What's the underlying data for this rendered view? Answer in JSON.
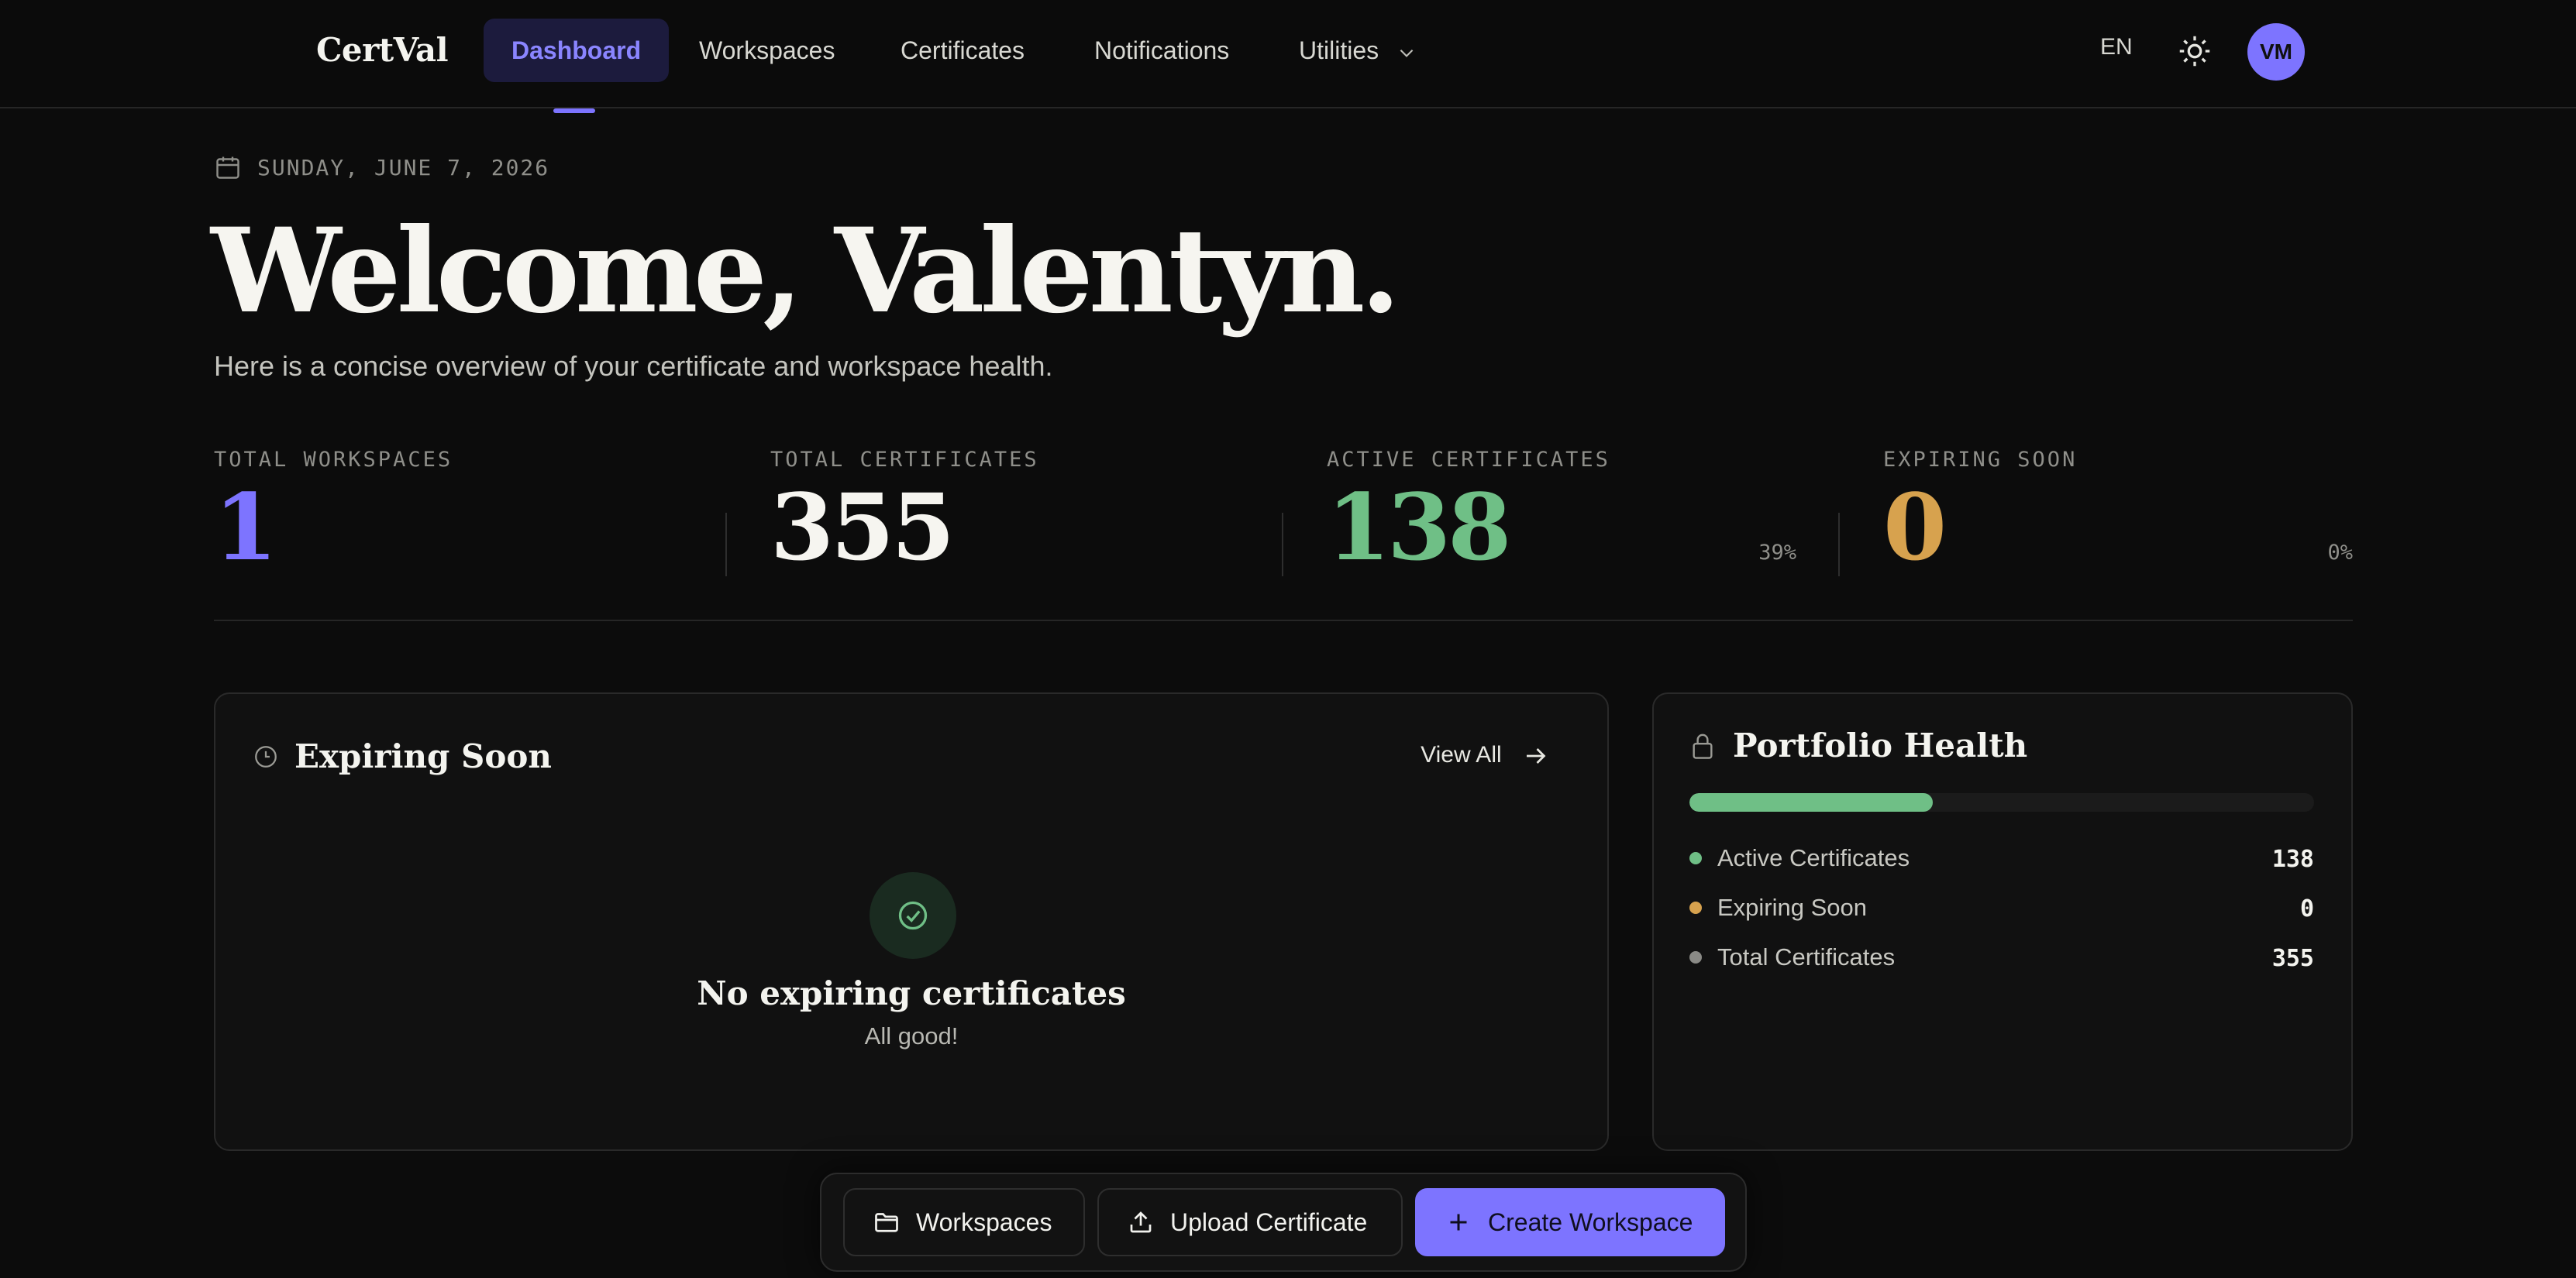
{
  "app": {
    "brand": "CertVal",
    "nav": [
      {
        "label": "Dashboard",
        "active": true
      },
      {
        "label": "Workspaces"
      },
      {
        "label": "Certificates"
      },
      {
        "label": "Notifications"
      },
      {
        "label": "Utilities",
        "has_dropdown": true
      }
    ],
    "language": "EN",
    "avatar_initials": "VM",
    "accent_color": "#7d74ff"
  },
  "header": {
    "date": "SUNDAY, JUNE 7, 2026",
    "welcome": "Welcome, Valentyn.",
    "subtitle": "Here is a concise overview of your certificate and workspace health."
  },
  "stats": [
    {
      "label": "TOTAL WORKSPACES",
      "value": "1",
      "color": "#7d74ff"
    },
    {
      "label": "TOTAL CERTIFICATES",
      "value": "355",
      "color": "#f6f5f0"
    },
    {
      "label": "ACTIVE CERTIFICATES",
      "value": "138",
      "percent": "39%",
      "color": "#6fbf86"
    },
    {
      "label": "EXPIRING SOON",
      "value": "0",
      "percent": "0%",
      "color": "#d7a24e"
    }
  ],
  "expiring_card": {
    "title": "Expiring Soon",
    "view_all": "View All",
    "empty_title": "No expiring certificates",
    "empty_subtitle": "All good!"
  },
  "portfolio_card": {
    "title": "Portfolio Health",
    "health_fraction": 0.39,
    "legend": [
      {
        "label": "Active Certificates",
        "value": "138",
        "color": "#6fbf86"
      },
      {
        "label": "Expiring Soon",
        "value": "0",
        "color": "#d7a24e"
      },
      {
        "label": "Total Certificates",
        "value": "355",
        "color": "#8a8a86"
      }
    ]
  },
  "actions": [
    {
      "label": "Workspaces",
      "icon": "folder-icon"
    },
    {
      "label": "Upload Certificate",
      "icon": "upload-icon"
    },
    {
      "label": "Create Workspace",
      "icon": "plus-icon",
      "primary": true
    }
  ]
}
